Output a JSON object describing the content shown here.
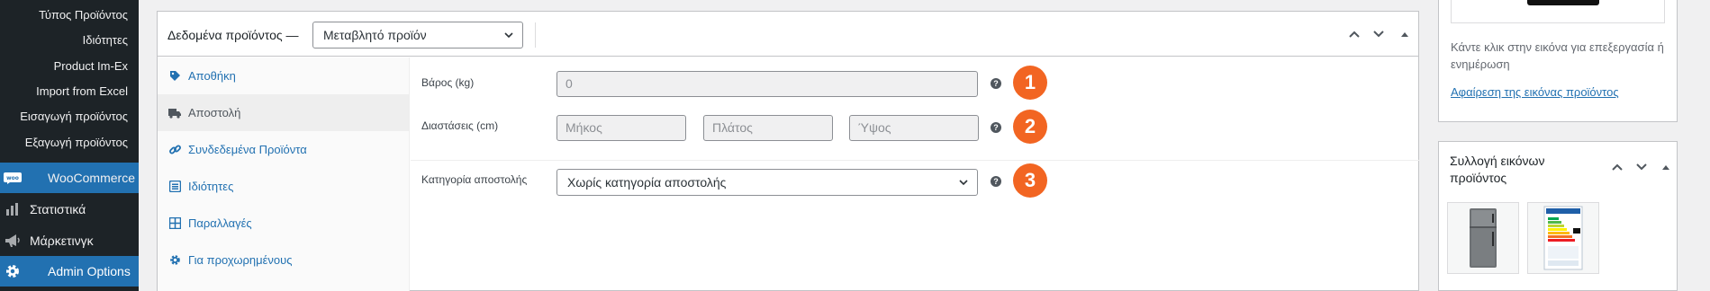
{
  "admin_menu": {
    "submenu": [
      "Τύπος Προϊόντος",
      "Ιδιότητες",
      "Product Im-Ex",
      "Import from Excel",
      "Εισαγωγή προϊόντος",
      "Εξαγωγή προϊόντος"
    ],
    "woocommerce": {
      "label": "WooCommerce",
      "icon": "woo-icon"
    },
    "items": [
      {
        "label": "Στατιστικά",
        "icon": "chart-bar-icon"
      },
      {
        "label": "Μάρκετινγκ",
        "icon": "megaphone-icon"
      },
      {
        "label": "Admin Options",
        "icon": "gear-icon"
      }
    ]
  },
  "product_data": {
    "title": "Δεδομένα προϊόντος —",
    "product_type": "Μεταβλητό προϊόν",
    "tabs": [
      {
        "label": "Αποθήκη",
        "icon": "tag-icon"
      },
      {
        "label": "Αποστολή",
        "icon": "truck-icon",
        "active": true
      },
      {
        "label": "Συνδεδεμένα Προϊόντα",
        "icon": "link-icon"
      },
      {
        "label": "Ιδιότητες",
        "icon": "list-icon"
      },
      {
        "label": "Παραλλαγές",
        "icon": "grid-icon"
      },
      {
        "label": "Για προχωρημένους",
        "icon": "gear-icon"
      }
    ],
    "shipping": {
      "weight_label": "Βάρος (kg)",
      "weight_placeholder": "0",
      "dimensions_label": "Διαστάσεις (cm)",
      "length_placeholder": "Μήκος",
      "width_placeholder": "Πλάτος",
      "height_placeholder": "Ύψος",
      "class_label": "Κατηγορία αποστολής",
      "class_value": "Χωρίς κατηγορία αποστολής",
      "help": "?"
    },
    "badges": [
      "1",
      "2",
      "3"
    ]
  },
  "product_image": {
    "hint": "Κάντε κλικ στην εικόνα για επεξεργασία ή ενημέρωση",
    "remove_link": "Αφαίρεση της εικόνας προϊόντος"
  },
  "gallery": {
    "title": "Συλλογή εικόνων προϊόντος"
  },
  "colors": {
    "admin_bar": "#1d2327",
    "accent": "#2271b1",
    "badge": "#f26522"
  }
}
